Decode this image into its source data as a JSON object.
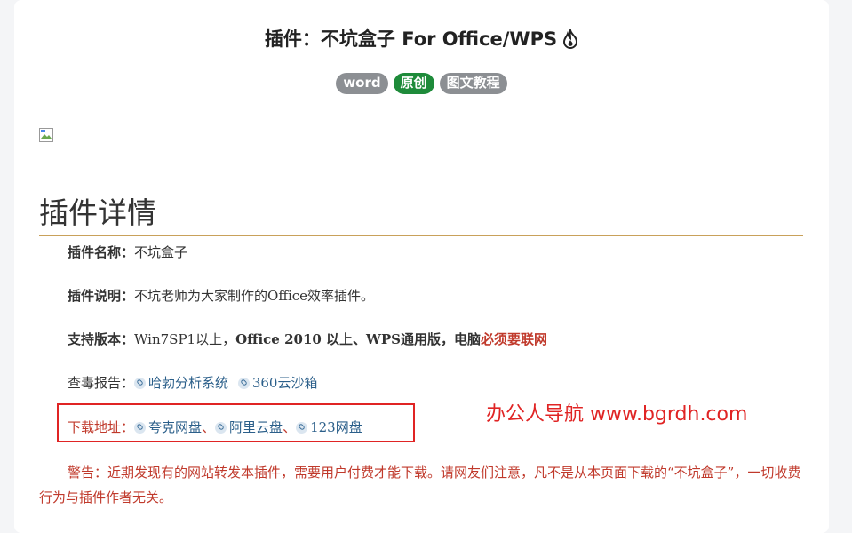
{
  "article": {
    "title": "插件：不坑盒子 For Office/WPS",
    "tags": [
      "word",
      "原创",
      "图文教程"
    ]
  },
  "section": {
    "heading": "插件详情"
  },
  "details": {
    "name_label": "插件名称：",
    "name_value": "不坑盒子",
    "desc_label": "插件说明：",
    "desc_value": "不坑老师为大家制作的Office效率插件。",
    "version_label": "支持版本：",
    "version_value_plain": "Win7SP1以上，",
    "version_value_bold": "Office 2010 以上、WPS通用版，电脑",
    "version_value_red": "必须要联网",
    "scan_label": "查毒报告：",
    "scan_links": [
      "哈勃分析系统",
      "360云沙箱"
    ],
    "download_label": "下载地址：",
    "download_links": [
      "夸克网盘",
      "阿里云盘",
      "123网盘"
    ],
    "download_sep": "、"
  },
  "watermark": "办公人导航 www.bgrdh.com",
  "warning": "警告：近期发现有的网站转发本插件，需要用户付费才能下载。请网友们注意，凡不是从本页面下载的“不坑盒子”，一切收费行为与插件作者无关。",
  "colors": {
    "accent_red": "#e02424",
    "tag_gray": "#8c8f93",
    "tag_green": "#1e8b3a",
    "link": "#2b5f8a"
  }
}
